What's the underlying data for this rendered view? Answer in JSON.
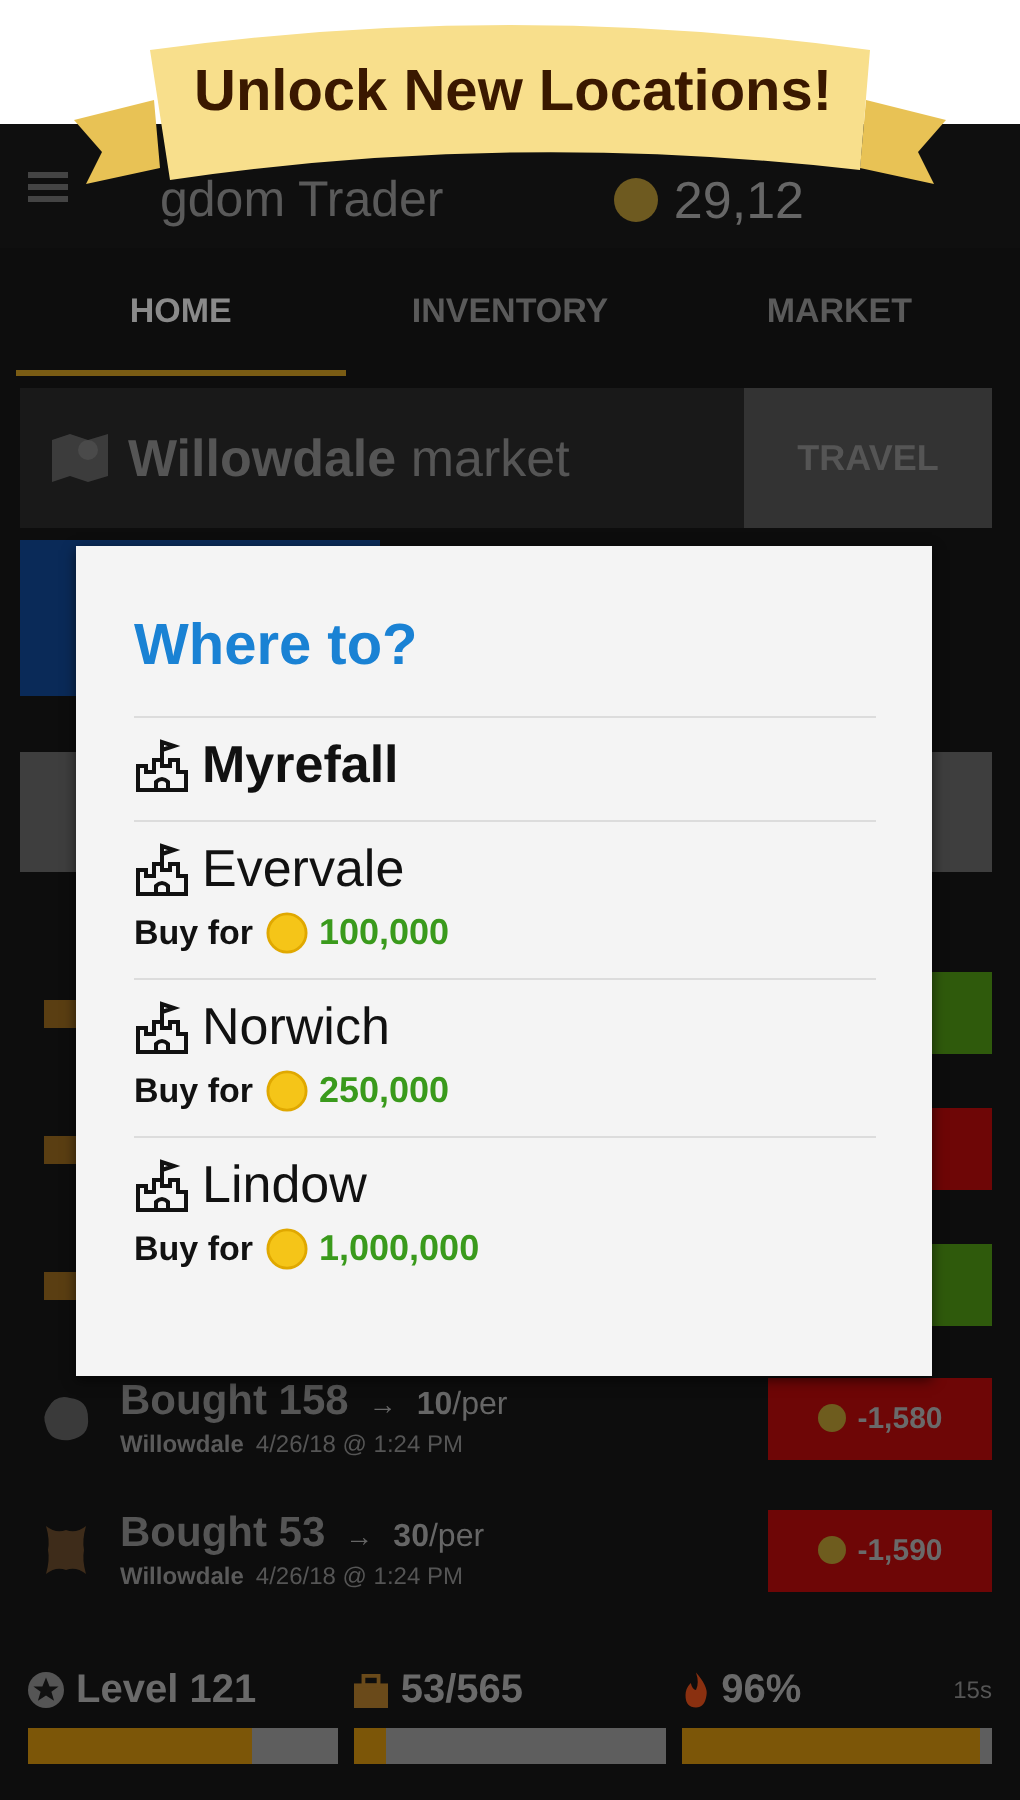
{
  "banner": {
    "text": "Unlock New Locations!"
  },
  "header": {
    "title": "gdom Trader",
    "coins": "29,12"
  },
  "tabs": [
    {
      "label": "HOME",
      "selected": true
    },
    {
      "label": "INVENTORY",
      "selected": false
    },
    {
      "label": "MARKET",
      "selected": false
    }
  ],
  "market": {
    "name": "Willowdale",
    "suffix": "market",
    "button": "TRAVEL"
  },
  "partial_rows": [
    {
      "kind": "gain"
    },
    {
      "kind": "loss"
    },
    {
      "kind": "gain"
    }
  ],
  "transactions": [
    {
      "kind": "loss",
      "action": "Bought 158",
      "arrow": "→",
      "price": "10",
      "unit": "/per",
      "place": "Willowdale",
      "time": "4/26/18 @ 1:24 PM",
      "amount": "-1,580"
    },
    {
      "kind": "loss",
      "action": "Bought 53",
      "arrow": "→",
      "price": "30",
      "unit": "/per",
      "place": "Willowdale",
      "time": "4/26/18 @ 1:24 PM",
      "amount": "-1,590"
    }
  ],
  "stats": [
    {
      "kind": "level",
      "label": "Level 121",
      "level": 0.72
    },
    {
      "kind": "storage",
      "label": "53/565",
      "level": 0.1
    },
    {
      "kind": "energy",
      "label": "96%",
      "level": 0.96,
      "timer": "15s"
    }
  ],
  "dialog": {
    "title": "Where to?",
    "locations": [
      {
        "name": "Myrefall",
        "selected": true
      },
      {
        "name": "Evervale",
        "selected": false,
        "buy_label": "Buy for",
        "price": "100,000"
      },
      {
        "name": "Norwich",
        "selected": false,
        "buy_label": "Buy for",
        "price": "250,000"
      },
      {
        "name": "Lindow",
        "selected": false,
        "buy_label": "Buy for",
        "price": "1,000,000"
      }
    ]
  }
}
